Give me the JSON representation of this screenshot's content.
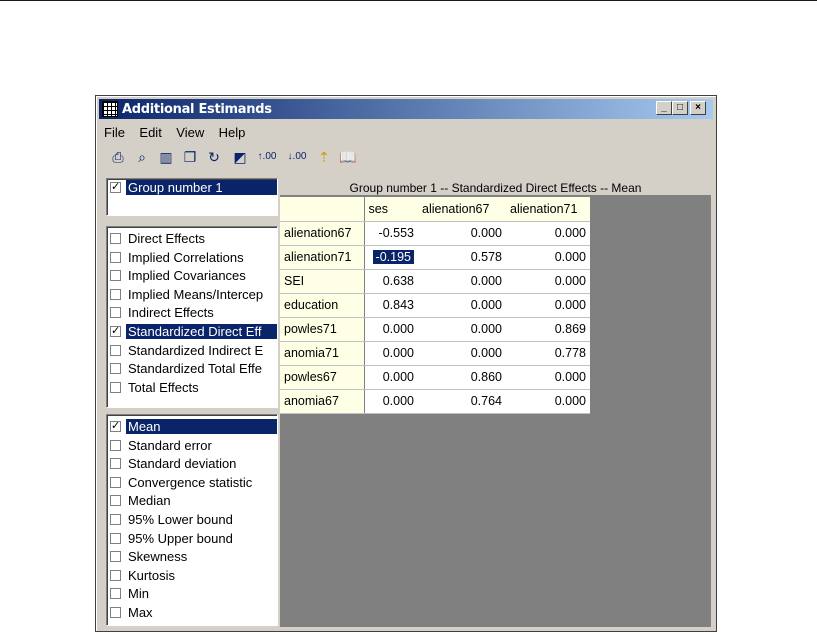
{
  "window": {
    "title": "Additional Estimands",
    "controls": [
      "_",
      "□",
      "×"
    ]
  },
  "menu": [
    "File",
    "Edit",
    "View",
    "Help"
  ],
  "toolbar": {
    "icons": [
      "print-icon",
      "print-preview-icon",
      "page-setup-icon",
      "copy-icon",
      "refresh-icon",
      "export-icon",
      "decimals-increase-icon",
      "decimals-decrease-icon",
      "up-level-icon",
      "help-book-icon"
    ],
    "glyphs": [
      "⎙",
      "⌕",
      "▥",
      "❐",
      "↻",
      "◩",
      "↑.00",
      "↓.00",
      "⇡",
      "📖"
    ]
  },
  "groups": [
    {
      "label": "Group number 1",
      "checked": true,
      "selected": true
    }
  ],
  "estimands": [
    {
      "label": "Direct Effects",
      "checked": false,
      "selected": false
    },
    {
      "label": "Implied Correlations",
      "checked": false,
      "selected": false
    },
    {
      "label": "Implied Covariances",
      "checked": false,
      "selected": false
    },
    {
      "label": "Implied Means/Intercep",
      "checked": false,
      "selected": false
    },
    {
      "label": "Indirect Effects",
      "checked": false,
      "selected": false
    },
    {
      "label": "Standardized Direct Eff",
      "checked": true,
      "selected": true
    },
    {
      "label": "Standardized Indirect E",
      "checked": false,
      "selected": false
    },
    {
      "label": "Standardized Total Effe",
      "checked": false,
      "selected": false
    },
    {
      "label": "Total Effects",
      "checked": false,
      "selected": false
    }
  ],
  "statistics": [
    {
      "label": "Mean",
      "checked": true,
      "selected": true
    },
    {
      "label": "Standard error",
      "checked": false,
      "selected": false
    },
    {
      "label": "Standard deviation",
      "checked": false,
      "selected": false
    },
    {
      "label": "Convergence statistic",
      "checked": false,
      "selected": false
    },
    {
      "label": "Median",
      "checked": false,
      "selected": false
    },
    {
      "label": "95% Lower bound",
      "checked": false,
      "selected": false
    },
    {
      "label": "95% Upper bound",
      "checked": false,
      "selected": false
    },
    {
      "label": "Skewness",
      "checked": false,
      "selected": false
    },
    {
      "label": "Kurtosis",
      "checked": false,
      "selected": false
    },
    {
      "label": "Min",
      "checked": false,
      "selected": false
    },
    {
      "label": "Max",
      "checked": false,
      "selected": false
    }
  ],
  "grid": {
    "caption": "Group number 1 -- Standardized Direct Effects -- Mean",
    "columns": [
      "ses",
      "alienation67",
      "alienation71"
    ],
    "rows": [
      {
        "name": "alienation67",
        "values": [
          "-0.553",
          "0.000",
          "0.000"
        ]
      },
      {
        "name": "alienation71",
        "values": [
          "-0.195",
          "0.578",
          "0.000"
        ]
      },
      {
        "name": "SEI",
        "values": [
          "0.638",
          "0.000",
          "0.000"
        ]
      },
      {
        "name": "education",
        "values": [
          "0.843",
          "0.000",
          "0.000"
        ]
      },
      {
        "name": "powles71",
        "values": [
          "0.000",
          "0.000",
          "0.869"
        ]
      },
      {
        "name": "anomia71",
        "values": [
          "0.000",
          "0.000",
          "0.778"
        ]
      },
      {
        "name": "powles67",
        "values": [
          "0.000",
          "0.860",
          "0.000"
        ]
      },
      {
        "name": "anomia67",
        "values": [
          "0.000",
          "0.764",
          "0.000"
        ]
      }
    ],
    "highlighted_cell": {
      "row": 1,
      "col": 0
    }
  },
  "colors": {
    "selection": "#0a246a",
    "face": "#d4d0c8",
    "grid_header": "#ffffe6",
    "grid_background": "#808080"
  }
}
